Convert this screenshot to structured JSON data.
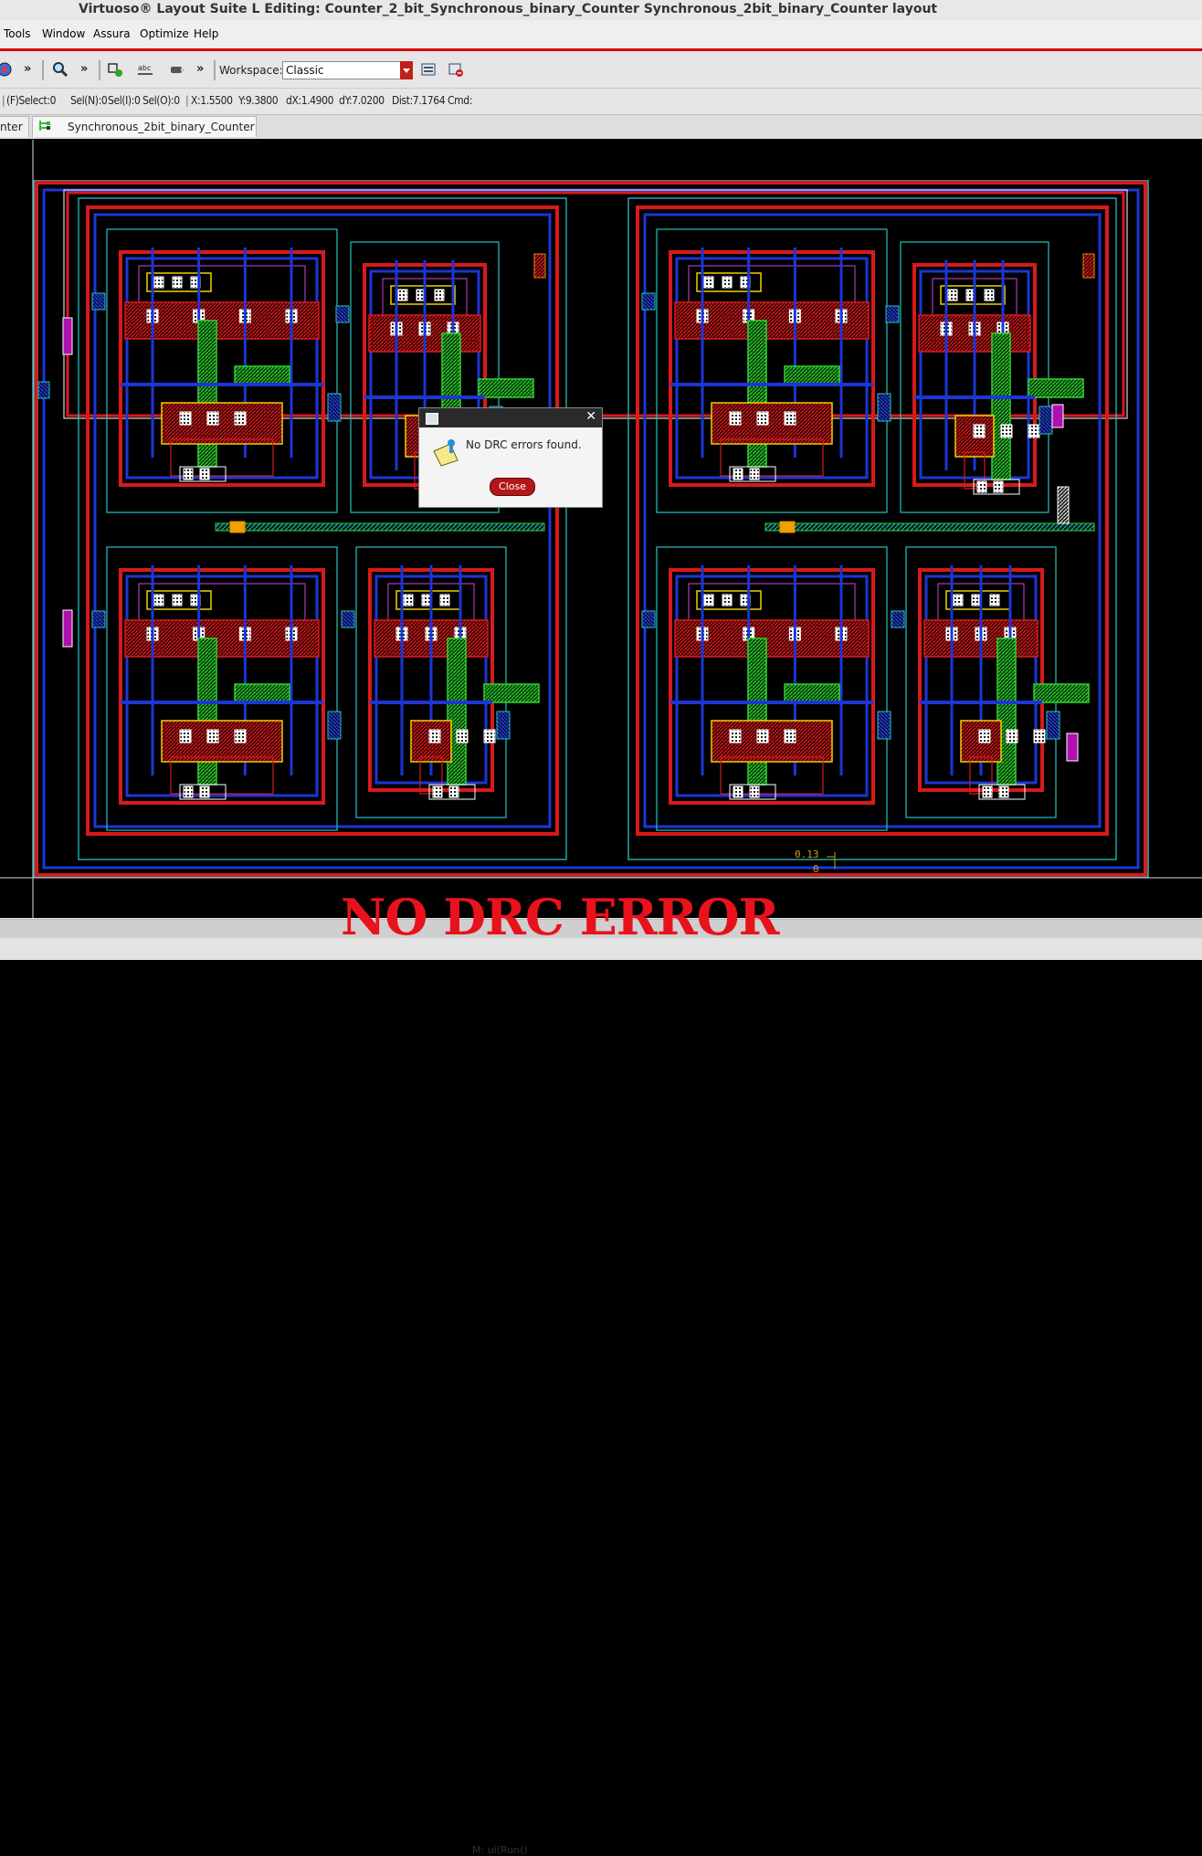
{
  "window": {
    "title": "Virtuoso® Layout Suite L Editing: Counter_2_bit_Synchronous_binary_Counter Synchronous_2bit_binary_Counter layout"
  },
  "menu": {
    "items": [
      "Tools",
      "Window",
      "Assura",
      "Optimize",
      "Help"
    ]
  },
  "toolbar": {
    "workspace_label": "Workspace:",
    "workspace_value": "Classic",
    "icons": [
      "design-icon",
      "zoom-icon",
      "create-icon",
      "label-icon",
      "probe-icon",
      "workspace-save-icon",
      "workspace-delete-icon"
    ]
  },
  "status": {
    "select": "(F)Select:0",
    "sel_n": "Sel(N):0",
    "sel_i": "Sel(I):0",
    "sel_o": "Sel(O):0",
    "x": "X:1.5500",
    "y": "Y:9.3800",
    "dx": "dX:1.4900",
    "dy": "dY:7.0200",
    "dist": "Dist:7.1764",
    "cmd": "Cmd:"
  },
  "tabs": [
    {
      "label": "nter"
    },
    {
      "label": "Synchronous_2bit_binary_Counter"
    }
  ],
  "dialog": {
    "message": "No DRC errors found.",
    "close_label": "Close"
  },
  "canvas": {
    "coord_a": "0.13",
    "coord_b": "0"
  },
  "bottom": {
    "mouse_hint": "M: ui(Run()"
  },
  "overlay": {
    "banner": "NO DRC ERROR"
  },
  "colors": {
    "metal1": "#1c36d6",
    "poly": "#d81a1a",
    "active": "#2fd12f",
    "nwell": "#27c0c0",
    "implant": "#b03ab8",
    "contact": "#f0f0f0",
    "accent_red": "#d40000"
  }
}
